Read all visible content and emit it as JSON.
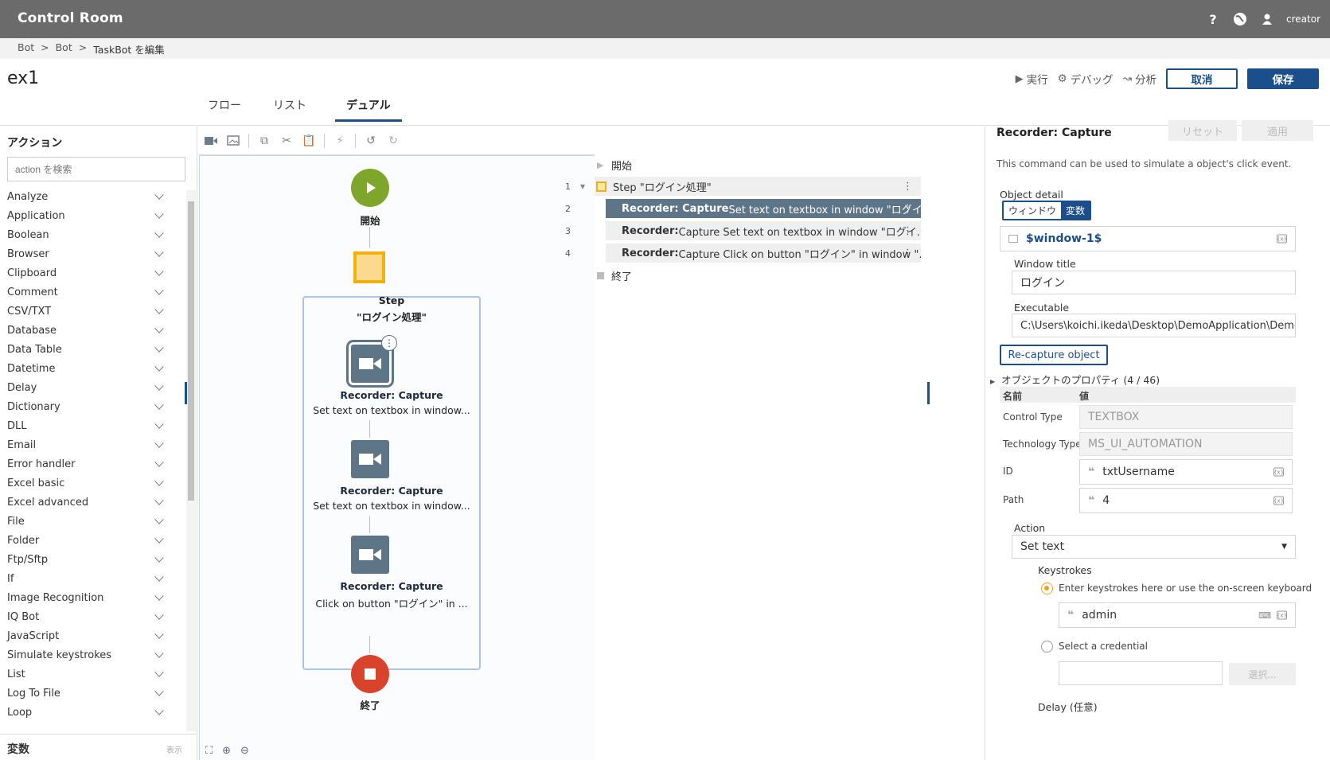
{
  "app": {
    "title": "Control Room",
    "user": "creator"
  },
  "breadcrumb": [
    "Bot",
    ">",
    "Bot",
    ">",
    "TaskBot を編集"
  ],
  "page": {
    "title": "ex1"
  },
  "tabs": [
    "フロー",
    "リスト",
    "デュアル"
  ],
  "toolbar_actions": {
    "run": "実行",
    "debug": "デバッグ",
    "analyze": "分析",
    "cancel": "取消",
    "save": "保存"
  },
  "actions_panel": {
    "header": "アクション",
    "search_placeholder": "action を検索",
    "items": [
      "Analyze",
      "Application",
      "Boolean",
      "Browser",
      "Clipboard",
      "Comment",
      "CSV/TXT",
      "Database",
      "Data Table",
      "Datetime",
      "Delay",
      "Dictionary",
      "DLL",
      "Email",
      "Error handler",
      "Excel basic",
      "Excel advanced",
      "File",
      "Folder",
      "Ftp/Sftp",
      "If",
      "Image Recognition",
      "IQ Bot",
      "JavaScript",
      "Simulate keystrokes",
      "List",
      "Log To File",
      "Loop"
    ],
    "variables_label": "変数",
    "variables_toggle": "表示"
  },
  "flow": {
    "start_label": "開始",
    "step_title": "Step",
    "step_name": "\"ログイン処理\"",
    "nodes": [
      {
        "title": "Recorder: Capture",
        "desc": "Set text on textbox in window..."
      },
      {
        "title": "Recorder: Capture",
        "desc": "Set text on textbox in window..."
      },
      {
        "title": "Recorder: Capture",
        "desc": "Click on button \"ログイン\" in ..."
      }
    ],
    "end_label": "終了"
  },
  "list": {
    "start": "開始",
    "end": "終了",
    "rows": [
      {
        "num": "1",
        "text": "Step \"ログイン処理\""
      },
      {
        "num": "2",
        "bold": "Recorder: Capture",
        "text": " Set text on textbox in window \"ログイ..."
      },
      {
        "num": "3",
        "bold": "Recorder:",
        "text": " Capture Set text on textbox in window \"ログイ..."
      },
      {
        "num": "4",
        "bold": "Recorder:",
        "text": " Capture Click on button \"ログイン\" in window \"..."
      }
    ]
  },
  "props": {
    "title": "Recorder: Capture",
    "reset": "リセット",
    "apply": "適用",
    "description": "This command can be used to simulate a object's click event.",
    "object_detail_label": "Object detail",
    "seg_window": "ウィンドウ",
    "seg_variable": "変数",
    "window_var": "$window-1$",
    "window_title_label": "Window title",
    "window_title_value": "ログイン",
    "executable_label": "Executable",
    "executable_value": "C:\\Users\\koichi.ikeda\\Desktop\\DemoApplication\\DemoI",
    "recapture": "Re-capture object",
    "object_props": "オブジェクトのプロパティ (4 / 46)",
    "col_name": "名前",
    "col_value": "値",
    "rows": [
      {
        "name": "Control Type",
        "value": "TEXTBOX"
      },
      {
        "name": "Technology Type",
        "value": "MS_UI_AUTOMATION"
      },
      {
        "name": "ID",
        "value": "txtUsername"
      },
      {
        "name": "Path",
        "value": "4"
      }
    ],
    "action_label": "Action",
    "action_value": "Set text",
    "keystrokes_label": "Keystrokes",
    "ks_option1": "Enter keystrokes here or use the on-screen keyboard",
    "ks_value": "admin",
    "ks_option2": "Select a credential",
    "select_btn": "選択...",
    "delay_label": "Delay (任意)"
  }
}
